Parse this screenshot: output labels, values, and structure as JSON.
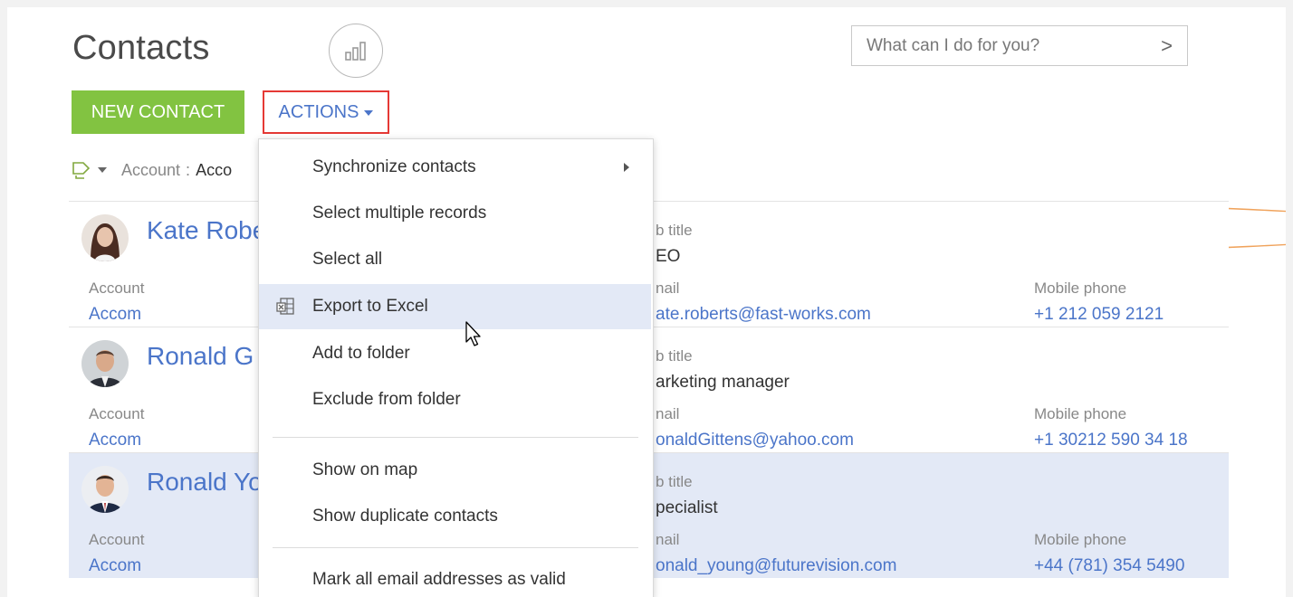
{
  "header": {
    "title": "Contacts",
    "search_placeholder": "What can I do for you?",
    "search_arrow": ">"
  },
  "toolbar": {
    "new_contact_label": "NEW CONTACT",
    "actions_label": "ACTIONS"
  },
  "filter": {
    "label": "Account",
    "separator": ":",
    "value": "Acco"
  },
  "records": [
    {
      "name": "Kate Robe",
      "job_title_label": "b title",
      "job_title": "EO",
      "account_label": "Account",
      "account": "Accom",
      "email_label": "nail",
      "email": "ate.roberts@fast-works.com",
      "mobile_label": "Mobile phone",
      "mobile": "+1 212 059 2121"
    },
    {
      "name": "Ronald G",
      "job_title_label": "b title",
      "job_title": "arketing manager",
      "account_label": "Account",
      "account": "Accom",
      "email_label": "nail",
      "email": "onaldGittens@yahoo.com",
      "mobile_label": "Mobile phone",
      "mobile": "+1 30212 590 34 18"
    },
    {
      "name": "Ronald Yo",
      "job_title_label": "b title",
      "job_title": "pecialist",
      "account_label": "Account",
      "account": "Accom",
      "email_label": "nail",
      "email": "onald_young@futurevision.com",
      "mobile_label": "Mobile phone",
      "mobile": "+44 (781) 354 5490"
    }
  ],
  "actions_menu": {
    "items": [
      {
        "label": "Synchronize contacts"
      },
      {
        "label": "Select multiple records"
      },
      {
        "label": "Select all"
      },
      {
        "label": "Export to Excel"
      },
      {
        "label": "Add to folder"
      },
      {
        "label": "Exclude from folder"
      },
      {
        "label": "Show on map"
      },
      {
        "label": "Show duplicate contacts"
      },
      {
        "label": "Mark all email addresses as valid"
      }
    ]
  },
  "colors": {
    "accent_blue": "#4b75c9",
    "new_contact_green": "#82c341",
    "actions_highlight_red": "#e53935",
    "list_view_orange": "#f0a35c",
    "selected_row": "#e3e9f6"
  }
}
